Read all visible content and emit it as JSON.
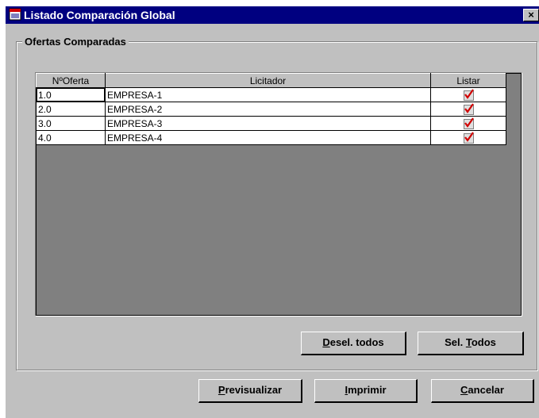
{
  "window": {
    "title": "Listado Comparación Global",
    "close_label": "×"
  },
  "group": {
    "title": "Ofertas Comparadas"
  },
  "table": {
    "headers": {
      "num": "NºOferta",
      "licitador": "Licitador",
      "listar": "Listar"
    },
    "rows": [
      {
        "num": "1.0",
        "licitador": "EMPRESA-1",
        "listar": true
      },
      {
        "num": "2.0",
        "licitador": "EMPRESA-2",
        "listar": true
      },
      {
        "num": "3.0",
        "licitador": "EMPRESA-3",
        "listar": true
      },
      {
        "num": "4.0",
        "licitador": "EMPRESA-4",
        "listar": true
      }
    ]
  },
  "buttons": {
    "deselect": {
      "mnemonic": "D",
      "rest": "esel. todos"
    },
    "select": {
      "prefix": "Sel. ",
      "mnemonic": "T",
      "rest": "odos"
    },
    "preview": {
      "mnemonic": "P",
      "rest": "revisualizar"
    },
    "print": {
      "mnemonic": "I",
      "rest": "mprimir"
    },
    "cancel": {
      "mnemonic": "C",
      "rest": "ancelar"
    }
  },
  "colors": {
    "titlebar": "#000080",
    "face": "#c0c0c0",
    "check": "#d00000"
  }
}
